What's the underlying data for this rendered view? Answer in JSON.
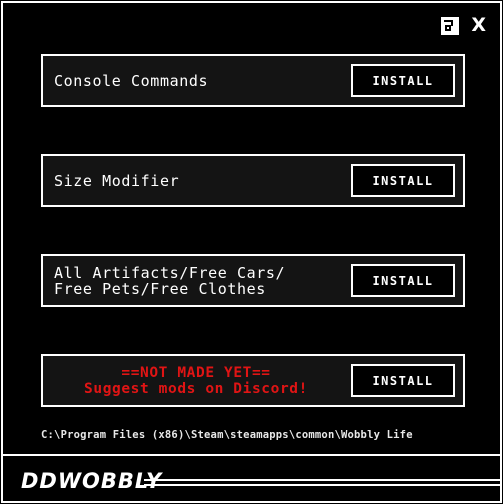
{
  "window": {
    "controls": {
      "minimize_icon": "window-restore-icon",
      "close_label": "X"
    }
  },
  "mods": [
    {
      "name_lines": [
        "Console Commands"
      ],
      "button_label": "INSTALL",
      "style": "normal"
    },
    {
      "name_lines": [
        "Size Modifier"
      ],
      "button_label": "INSTALL",
      "style": "normal"
    },
    {
      "name_lines": [
        "All Artifacts/Free Cars/",
        "Free Pets/Free Clothes"
      ],
      "button_label": "INSTALL",
      "style": "normal"
    },
    {
      "name_lines": [
        "==NOT MADE YET==",
        "Suggest mods on Discord!"
      ],
      "button_label": "INSTALL",
      "style": "notice"
    }
  ],
  "install_path": "C:\\Program Files (x86)\\Steam\\steamapps\\common\\Wobbly Life",
  "brand": "DDWOBBLY",
  "colors": {
    "background": "#000000",
    "border": "#ffffff",
    "panel": "#141414",
    "notice_red": "#e11414"
  }
}
